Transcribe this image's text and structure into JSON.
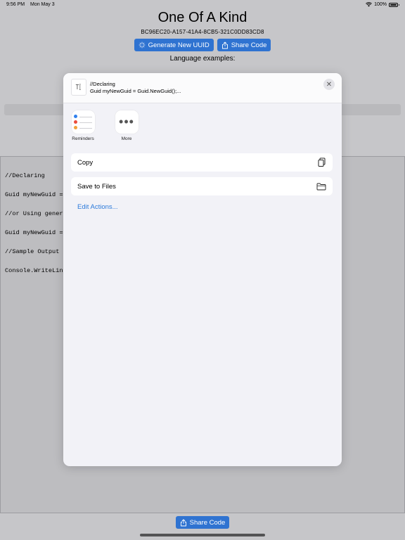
{
  "status_bar": {
    "time": "9:56 PM",
    "date": "Mon May 3",
    "battery": "100%",
    "battery_level": 1.0
  },
  "app": {
    "title": "One Of A Kind",
    "uuid": "BC96EC20-A157-41A4-8CB5-321C0DD83CD8",
    "generate_button": "Generate New UUID",
    "share_button": "Share Code",
    "language_label": "Language examples:",
    "code_lines": [
      "//Declaring",
      "Guid myNewGuid =",
      "//or Using gener",
      "Guid myNewGuid =",
      "//Sample Output",
      "Console.WriteLin"
    ],
    "bottom_share_button": "Share Code"
  },
  "share_sheet": {
    "preview_line1": "//Declaring",
    "preview_line2": "Guid myNewGuid = Guid.NewGuid();...",
    "close_glyph": "✕",
    "apps": [
      {
        "label": "Reminders",
        "icon": "reminders-icon"
      },
      {
        "label": "More",
        "icon": "more-icon"
      }
    ],
    "actions": [
      {
        "label": "Copy",
        "icon": "copy-icon"
      },
      {
        "label": "Save to Files",
        "icon": "folder-icon"
      }
    ],
    "edit_actions": "Edit Actions..."
  },
  "colors": {
    "accent": "#2f73d1",
    "link": "#2d7bdb",
    "reminder_dots": [
      "#2f80ed",
      "#eb4d3d",
      "#f2a23a"
    ]
  }
}
